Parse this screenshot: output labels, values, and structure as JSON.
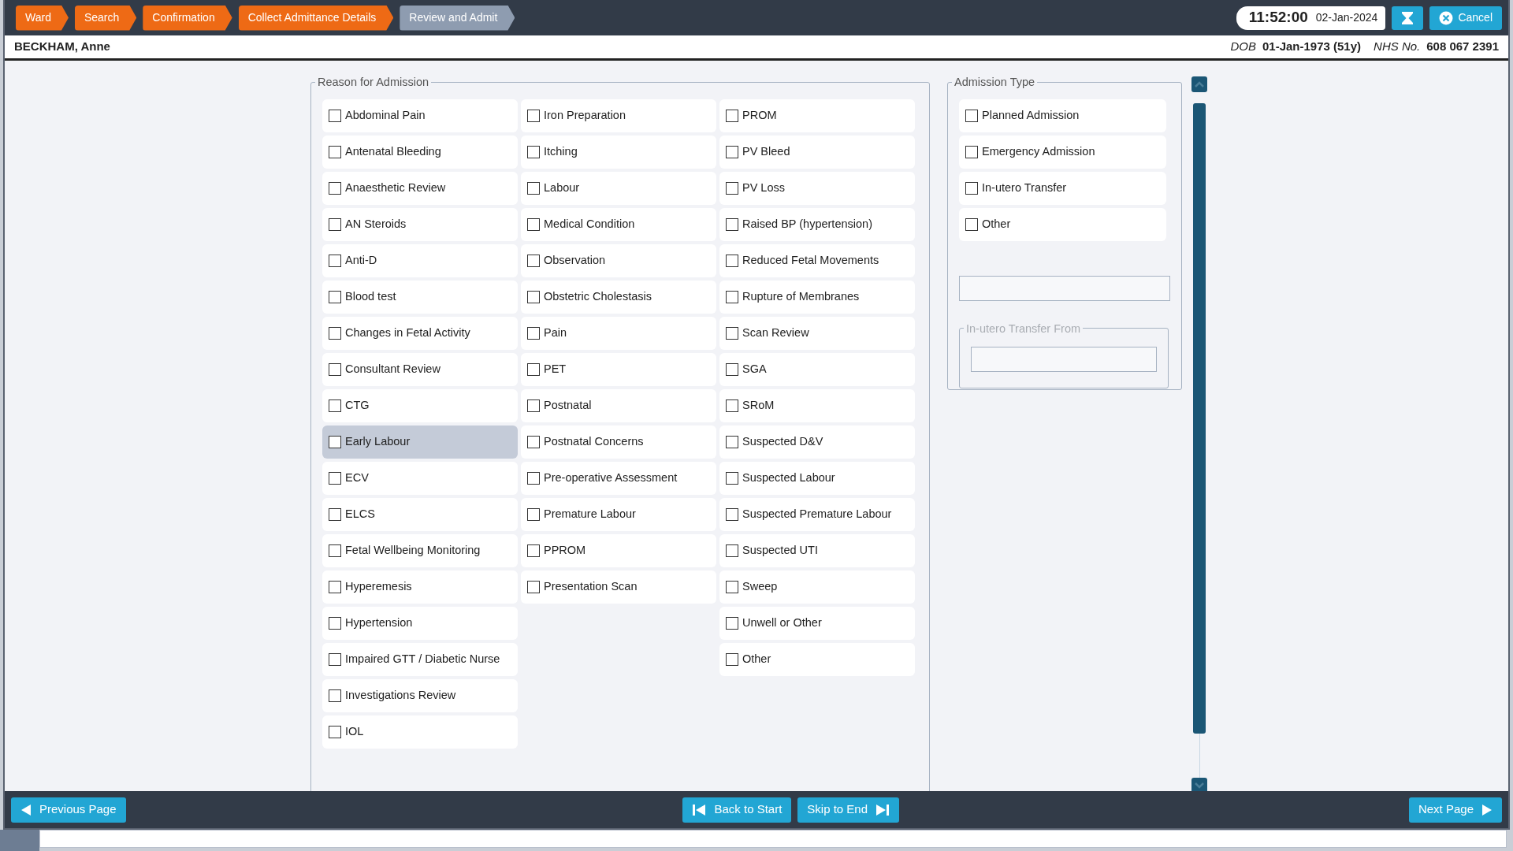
{
  "breadcrumb": [
    {
      "label": "Ward",
      "current": false
    },
    {
      "label": "Search",
      "current": false
    },
    {
      "label": "Confirmation",
      "current": false
    },
    {
      "label": "Collect Admittance Details",
      "current": false
    },
    {
      "label": "Review and Admit",
      "current": true
    }
  ],
  "clock": {
    "time": "11:52:00",
    "date": "02-Jan-2024"
  },
  "cancel_button": "Cancel",
  "patient": {
    "name": "BECKHAM, Anne",
    "dob_label": "DOB",
    "dob": "01-Jan-1973 (51y)",
    "nhs_label": "NHS No.",
    "nhs": "608 067 2391"
  },
  "reason_for_admission": {
    "title": "Reason for Admission",
    "columns": [
      [
        {
          "label": "Abdominal Pain",
          "checked": false,
          "selected": false
        },
        {
          "label": "Antenatal Bleeding",
          "checked": false,
          "selected": false
        },
        {
          "label": "Anaesthetic Review",
          "checked": false,
          "selected": false
        },
        {
          "label": "AN Steroids",
          "checked": false,
          "selected": false
        },
        {
          "label": "Anti-D",
          "checked": false,
          "selected": false
        },
        {
          "label": "Blood test",
          "checked": false,
          "selected": false
        },
        {
          "label": "Changes in Fetal Activity",
          "checked": false,
          "selected": false
        },
        {
          "label": "Consultant Review",
          "checked": false,
          "selected": false
        },
        {
          "label": "CTG",
          "checked": false,
          "selected": false
        },
        {
          "label": "Early Labour",
          "checked": false,
          "selected": true
        },
        {
          "label": "ECV",
          "checked": false,
          "selected": false
        },
        {
          "label": "ELCS",
          "checked": false,
          "selected": false
        },
        {
          "label": "Fetal Wellbeing Monitoring",
          "checked": false,
          "selected": false
        },
        {
          "label": "Hyperemesis",
          "checked": false,
          "selected": false
        },
        {
          "label": "Hypertension",
          "checked": false,
          "selected": false
        },
        {
          "label": "Impaired GTT / Diabetic Nurse",
          "checked": false,
          "selected": false
        },
        {
          "label": "Investigations Review",
          "checked": false,
          "selected": false
        },
        {
          "label": "IOL",
          "checked": false,
          "selected": false
        }
      ],
      [
        {
          "label": "Iron Preparation",
          "checked": false,
          "selected": false
        },
        {
          "label": "Itching",
          "checked": false,
          "selected": false
        },
        {
          "label": "Labour",
          "checked": false,
          "selected": false
        },
        {
          "label": "Medical Condition",
          "checked": false,
          "selected": false
        },
        {
          "label": "Observation",
          "checked": false,
          "selected": false
        },
        {
          "label": "Obstetric Cholestasis",
          "checked": false,
          "selected": false
        },
        {
          "label": "Pain",
          "checked": false,
          "selected": false
        },
        {
          "label": "PET",
          "checked": false,
          "selected": false
        },
        {
          "label": "Postnatal",
          "checked": false,
          "selected": false
        },
        {
          "label": "Postnatal Concerns",
          "checked": false,
          "selected": false
        },
        {
          "label": "Pre-operative Assessment",
          "checked": false,
          "selected": false
        },
        {
          "label": "Premature Labour",
          "checked": false,
          "selected": false
        },
        {
          "label": "PPROM",
          "checked": false,
          "selected": false
        },
        {
          "label": "Presentation Scan",
          "checked": false,
          "selected": false
        }
      ],
      [
        {
          "label": "PROM",
          "checked": false,
          "selected": false
        },
        {
          "label": "PV Bleed",
          "checked": false,
          "selected": false
        },
        {
          "label": "PV Loss",
          "checked": false,
          "selected": false
        },
        {
          "label": "Raised BP (hypertension)",
          "checked": false,
          "selected": false
        },
        {
          "label": "Reduced Fetal Movements",
          "checked": false,
          "selected": false
        },
        {
          "label": "Rupture of Membranes",
          "checked": false,
          "selected": false
        },
        {
          "label": "Scan Review",
          "checked": false,
          "selected": false
        },
        {
          "label": "SGA",
          "checked": false,
          "selected": false
        },
        {
          "label": "SRoM",
          "checked": false,
          "selected": false
        },
        {
          "label": "Suspected D&V",
          "checked": false,
          "selected": false
        },
        {
          "label": "Suspected Labour",
          "checked": false,
          "selected": false
        },
        {
          "label": "Suspected Premature Labour",
          "checked": false,
          "selected": false
        },
        {
          "label": "Suspected UTI",
          "checked": false,
          "selected": false
        },
        {
          "label": "Sweep",
          "checked": false,
          "selected": false
        },
        {
          "label": "Unwell or Other",
          "checked": false,
          "selected": false
        },
        {
          "label": "Other",
          "checked": false,
          "selected": false
        }
      ]
    ]
  },
  "admission_type": {
    "title": "Admission Type",
    "options": [
      {
        "label": "Planned Admission",
        "checked": false,
        "selected": false
      },
      {
        "label": "Emergency Admission",
        "checked": false,
        "selected": false
      },
      {
        "label": "In-utero Transfer",
        "checked": false,
        "selected": false
      },
      {
        "label": "Other",
        "checked": false,
        "selected": false
      }
    ],
    "transfer_from": {
      "title": "In-utero Transfer From",
      "disabled": true
    }
  },
  "footer": {
    "previous": "Previous Page",
    "back_to_start": "Back to Start",
    "skip_to_end": "Skip to End",
    "next": "Next Page"
  }
}
